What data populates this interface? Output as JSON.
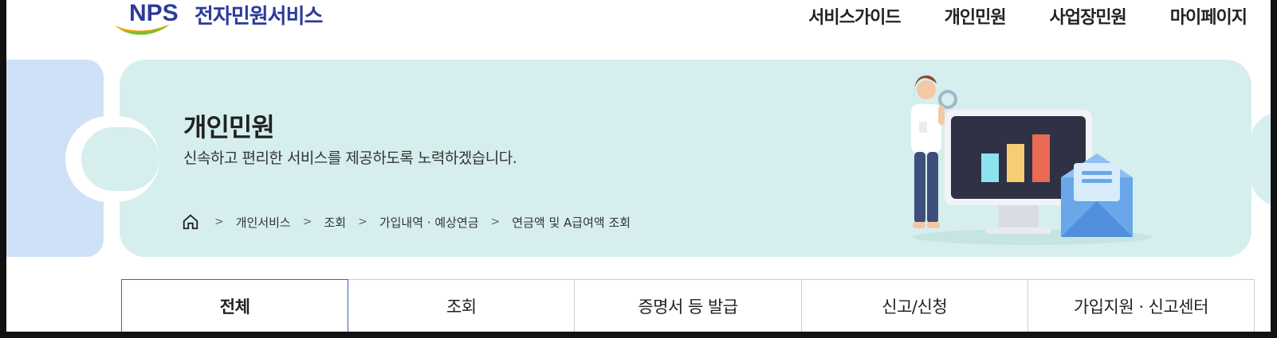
{
  "header": {
    "logo_mark": "NPS",
    "service_name": "전자민원서비스",
    "nav": [
      "서비스가이드",
      "개인민원",
      "사업장민원",
      "마이페이지"
    ]
  },
  "banner": {
    "title": "개인민원",
    "subtitle": "신속하고 편리한 서비스를 제공하도록 노력하겠습니다.",
    "breadcrumb": [
      "개인서비스",
      "조회",
      "가입내역 · 예상연금",
      "연금액 및 A급여액 조회"
    ]
  },
  "tabs": [
    "전체",
    "조회",
    "증명서 등 발급",
    "신고/신청",
    "가입지원 · 신고센터"
  ],
  "colors": {
    "banner_bg": "#d6efee",
    "side_tab_bg": "#cfe1f7",
    "brand_blue": "#2b3b9a",
    "active_tab_border": "#3c5ec9"
  }
}
